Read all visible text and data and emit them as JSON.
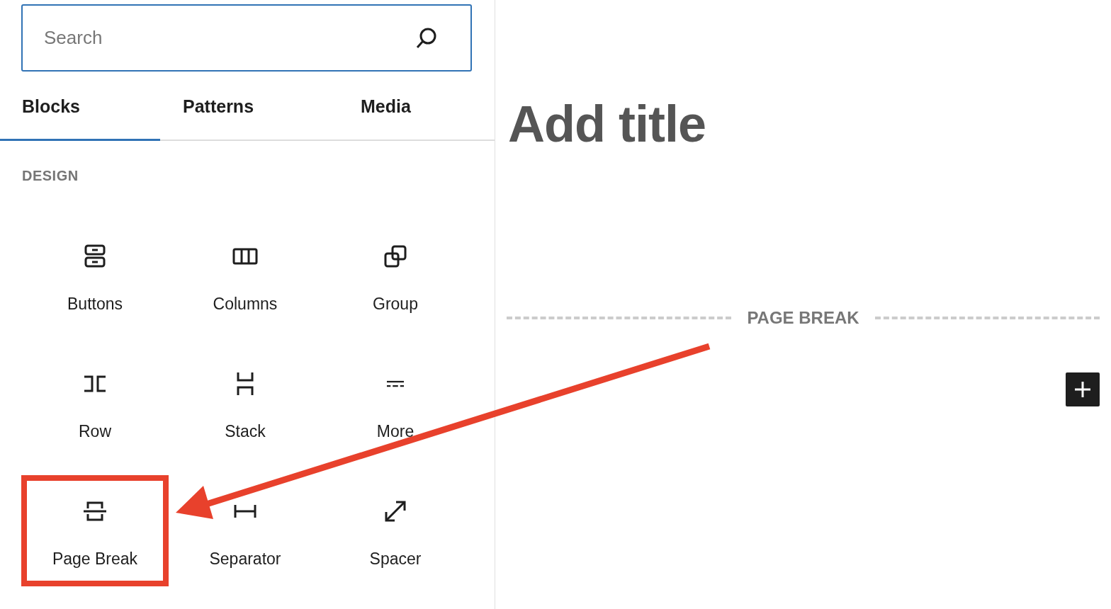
{
  "search": {
    "placeholder": "Search"
  },
  "tabs": [
    {
      "label": "Blocks",
      "selected": true
    },
    {
      "label": "Patterns",
      "selected": false
    },
    {
      "label": "Media",
      "selected": false
    }
  ],
  "category": "DESIGN",
  "blocks": [
    {
      "label": "Buttons",
      "highlighted": false
    },
    {
      "label": "Columns",
      "highlighted": false
    },
    {
      "label": "Group",
      "highlighted": false
    },
    {
      "label": "Row",
      "highlighted": false
    },
    {
      "label": "Stack",
      "highlighted": false
    },
    {
      "label": "More",
      "highlighted": false
    },
    {
      "label": "Page Break",
      "highlighted": true
    },
    {
      "label": "Separator",
      "highlighted": false
    },
    {
      "label": "Spacer",
      "highlighted": false
    }
  ],
  "editor": {
    "title_placeholder": "Add title",
    "page_break": "PAGE BREAK"
  }
}
